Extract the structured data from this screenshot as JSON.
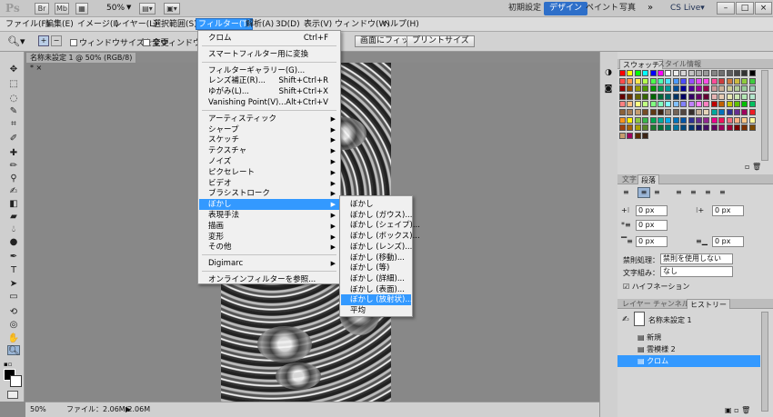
{
  "app": {
    "logo": "Ps",
    "zoom": "50%",
    "workspaces": [
      "初期設定",
      "デザイン",
      "ペイント",
      "写真"
    ],
    "active_workspace": "デザイン",
    "cs_live": "CS Live▾"
  },
  "menubar": [
    "ファイル(F)",
    "編集(E)",
    "イメージ(I)",
    "レイヤー(L)",
    "選択範囲(S)",
    "フィルター(T)",
    "解析(A)",
    "3D(D)",
    "表示(V)",
    "ウィンドウ(W)",
    "ヘルプ(H)"
  ],
  "options": {
    "resize_window": "ウィンドウサイズを変更",
    "all_windows": "全ウィンドウをズー",
    "fit_screen": "画面にフィット",
    "print_size": "プリントサイズ"
  },
  "document": {
    "tab": "名称未設定 1 @ 50% (RGB/8) *",
    "status_zoom": "50%",
    "status_file": "ファイル：2.06M/2.06M"
  },
  "filter_menu": [
    {
      "label": "クロム",
      "shortcut": "Ctrl+F"
    },
    {
      "sep": true
    },
    {
      "label": "スマートフィルター用に変換"
    },
    {
      "sep": true
    },
    {
      "label": "フィルターギャラリー(G)..."
    },
    {
      "label": "レンズ補正(R)...",
      "shortcut": "Shift+Ctrl+R"
    },
    {
      "label": "ゆがみ(L)...",
      "shortcut": "Shift+Ctrl+X"
    },
    {
      "label": "Vanishing Point(V)...",
      "shortcut": "Alt+Ctrl+V"
    },
    {
      "sep": true
    },
    {
      "label": "アーティスティック",
      "sub": true
    },
    {
      "label": "シャープ",
      "sub": true
    },
    {
      "label": "スケッチ",
      "sub": true
    },
    {
      "label": "テクスチャ",
      "sub": true
    },
    {
      "label": "ノイズ",
      "sub": true
    },
    {
      "label": "ピクセレート",
      "sub": true
    },
    {
      "label": "ビデオ",
      "sub": true
    },
    {
      "label": "ブラシストローク",
      "sub": true
    },
    {
      "label": "ぼかし",
      "sub": true,
      "highlight": true
    },
    {
      "label": "表現手法",
      "sub": true
    },
    {
      "label": "描画",
      "sub": true
    },
    {
      "label": "変形",
      "sub": true
    },
    {
      "label": "その他",
      "sub": true
    },
    {
      "sep": true
    },
    {
      "label": "Digimarc",
      "sub": true
    },
    {
      "sep": true
    },
    {
      "label": "オンラインフィルターを参照..."
    }
  ],
  "blur_submenu": [
    {
      "label": "ぼかし"
    },
    {
      "label": "ぼかし (ガウス)..."
    },
    {
      "label": "ぼかし (シェイプ)..."
    },
    {
      "label": "ぼかし (ボックス)..."
    },
    {
      "label": "ぼかし (レンズ)..."
    },
    {
      "label": "ぼかし (移動)..."
    },
    {
      "label": "ぼかし (等)"
    },
    {
      "label": "ぼかし (詳細)..."
    },
    {
      "label": "ぼかし (表面)..."
    },
    {
      "label": "ぼかし (放射状)...",
      "highlight": true
    },
    {
      "label": "平均"
    }
  ],
  "swatch_panel": {
    "tabs": [
      "スウォッチ",
      "スタイル",
      "情報"
    ]
  },
  "paragraph_panel": {
    "tabs": [
      "文字",
      "段落"
    ],
    "indent_left": "0 px",
    "indent_right": "0 px",
    "indent_first": "0 px",
    "space_before": "0 px",
    "space_after": "0 px",
    "kinsoku_label": "禁則処理：",
    "kinsoku_value": "禁則を使用しない",
    "mojikumi_label": "文字組み：",
    "mojikumi_value": "なし",
    "hyphenation": "ハイフネーション"
  },
  "history_panel": {
    "tabs": [
      "レイヤー",
      "チャンネル",
      "ヒストリー"
    ],
    "snapshot": "名称未設定 1",
    "items": [
      "新規",
      "雲模様 2",
      "クロム"
    ],
    "selected": "クロム"
  }
}
